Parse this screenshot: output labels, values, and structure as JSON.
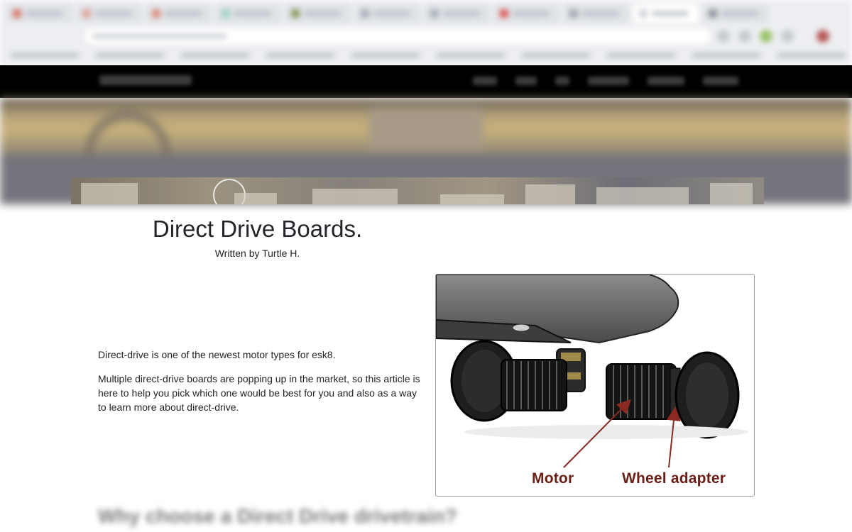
{
  "article": {
    "title": "Direct Drive Boards.",
    "byline": "Written by Turtle H.",
    "paragraphs": [
      "Direct-drive is one of the newest motor types for esk8.",
      "Multiple direct-drive boards are popping up in the market, so this article is here to help you pick which one would be best for you and also as a way to learn more about direct-drive."
    ],
    "next_heading": "Why choose a Direct Drive drivetrain?"
  },
  "figure": {
    "labels": {
      "motor": "Motor",
      "wheel_adapter": "Wheel adapter"
    }
  },
  "colors": {
    "navbar": "#000000",
    "label_text": "#6b1f17",
    "arrow": "#8a2a22"
  },
  "icons": [
    "favicon-icon",
    "extension-icon",
    "profile-avatar-icon"
  ]
}
